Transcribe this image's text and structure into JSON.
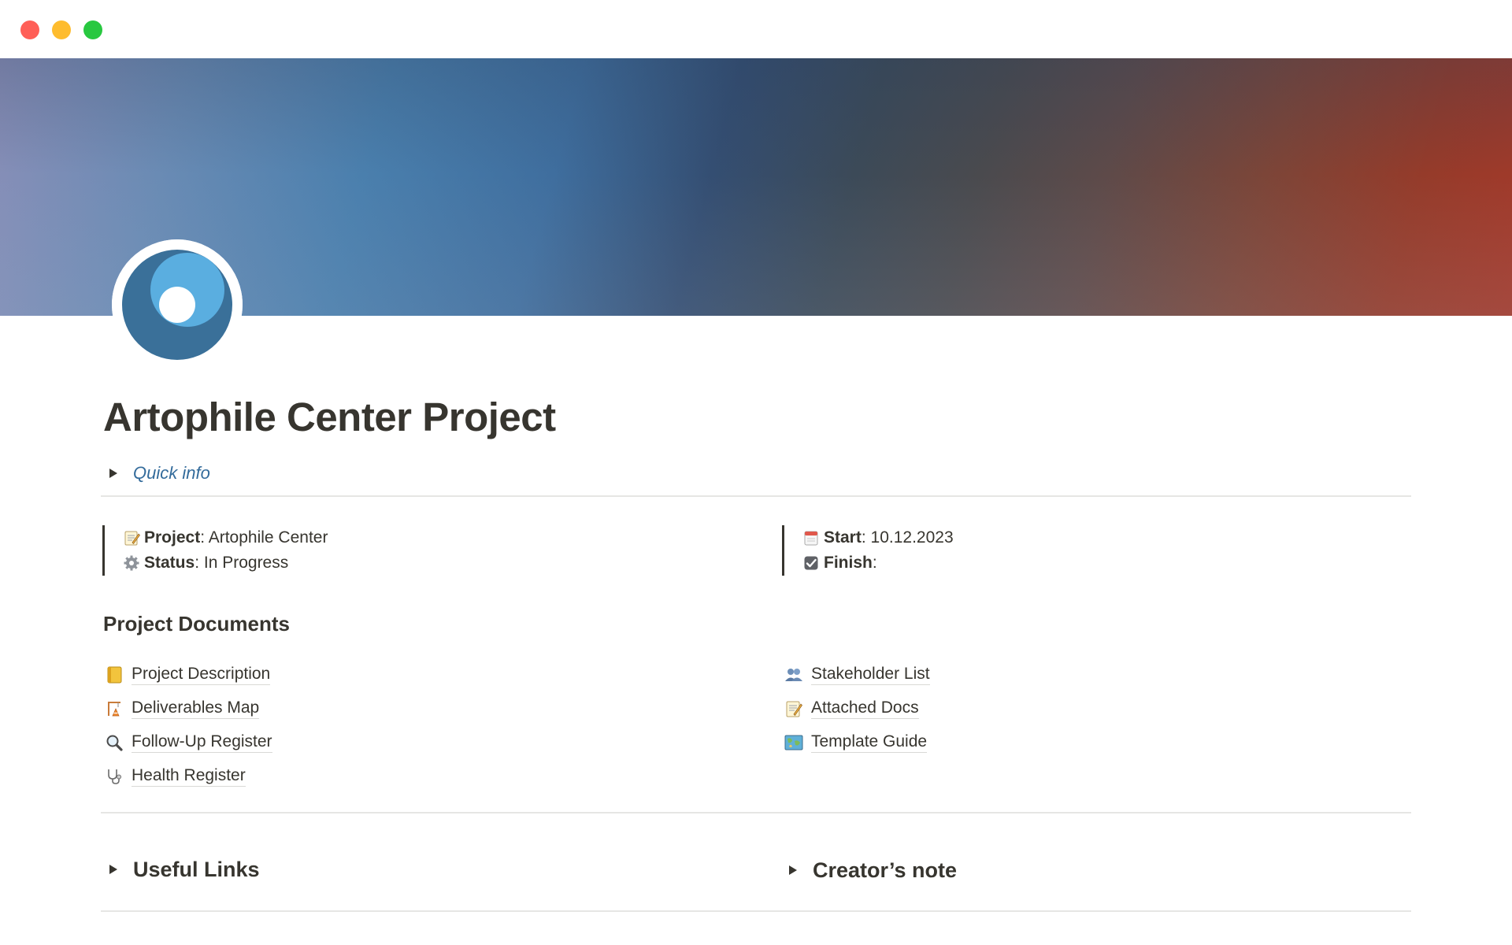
{
  "window": {
    "controls": [
      {
        "name": "close",
        "color": "#ff5f57"
      },
      {
        "name": "minimize",
        "color": "#febc2e"
      },
      {
        "name": "zoom",
        "color": "#28c840"
      }
    ]
  },
  "page": {
    "title": "Artophile Center Project",
    "quick_info_label": "Quick info",
    "cover_colors": [
      "#8a8fb8",
      "#3f6e9e",
      "#3c4a58",
      "#a3392a"
    ]
  },
  "properties": {
    "left": [
      {
        "icon": "memo-icon",
        "key": "Project",
        "value": ": Artophile Center"
      },
      {
        "icon": "gear-icon",
        "key": "Status",
        "value": ": In Progress"
      }
    ],
    "right": [
      {
        "icon": "calendar-icon",
        "key": "Start",
        "value": ": 10.12.2023"
      },
      {
        "icon": "check-box-icon",
        "key": "Finish",
        "value": ":"
      }
    ]
  },
  "documents": {
    "heading": "Project Documents",
    "left": [
      {
        "icon": "ledger-icon",
        "label": "Project Description"
      },
      {
        "icon": "construction-icon",
        "label": "Deliverables Map"
      },
      {
        "icon": "magnifier-icon",
        "label": "Follow-Up Register"
      },
      {
        "icon": "stethoscope-icon",
        "label": "Health Register"
      }
    ],
    "right": [
      {
        "icon": "people-icon",
        "label": "Stakeholder List"
      },
      {
        "icon": "memo-icon",
        "label": "Attached Docs"
      },
      {
        "icon": "map-icon",
        "label": "Template Guide"
      }
    ]
  },
  "toggles": {
    "useful_links": "Useful Links",
    "creators_note": "Creator’s note"
  }
}
